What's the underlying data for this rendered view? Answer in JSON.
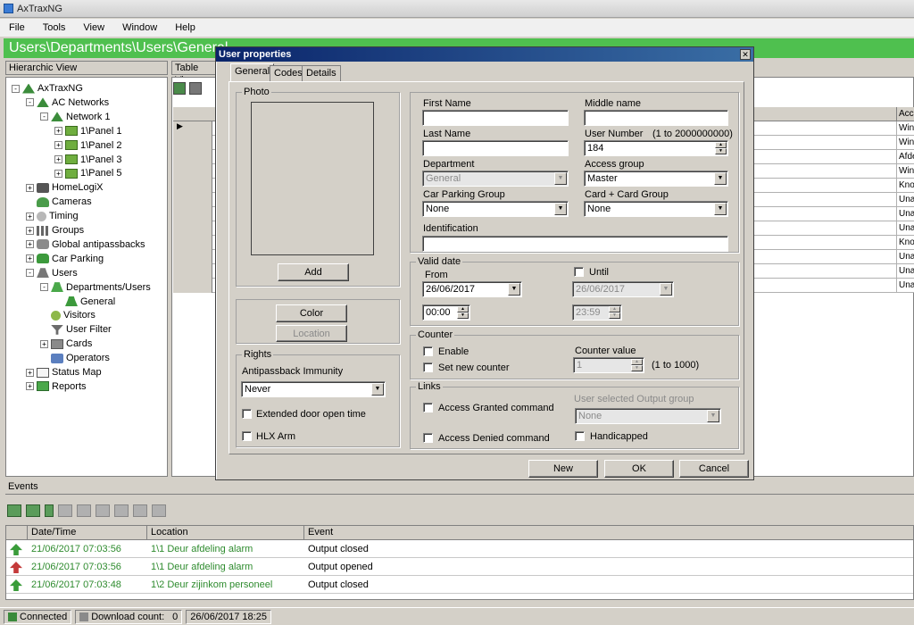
{
  "app": {
    "title": "AxTraxNG"
  },
  "menu": [
    "File",
    "Tools",
    "View",
    "Window",
    "Help"
  ],
  "path": "Users\\Departments\\Users\\General",
  "tree_header": "Hierarchic View",
  "table_header": "Table View",
  "tree": [
    {
      "label": "AxTraxNG",
      "level": 0,
      "exp": "-",
      "icon": "root-icon"
    },
    {
      "label": "AC Networks",
      "level": 1,
      "exp": "-",
      "icon": "network-icon"
    },
    {
      "label": "Network 1",
      "level": 2,
      "exp": "-",
      "icon": "network-icon"
    },
    {
      "label": "1\\Panel 1",
      "level": 3,
      "exp": "+",
      "icon": "panel-icon"
    },
    {
      "label": "1\\Panel 2",
      "level": 3,
      "exp": "+",
      "icon": "panel-icon"
    },
    {
      "label": "1\\Panel 3",
      "level": 3,
      "exp": "+",
      "icon": "panel-icon"
    },
    {
      "label": "1\\Panel 5",
      "level": 3,
      "exp": "+",
      "icon": "panel-icon"
    },
    {
      "label": "HomeLogiX",
      "level": 1,
      "exp": "+",
      "icon": "homelogix-icon"
    },
    {
      "label": "Cameras",
      "level": 1,
      "exp": "",
      "icon": "camera-icon"
    },
    {
      "label": "Timing",
      "level": 1,
      "exp": "+",
      "icon": "timing-icon"
    },
    {
      "label": "Groups",
      "level": 1,
      "exp": "+",
      "icon": "groups-icon"
    },
    {
      "label": "Global antipassbacks",
      "level": 1,
      "exp": "+",
      "icon": "antipassback-icon"
    },
    {
      "label": "Car Parking",
      "level": 1,
      "exp": "+",
      "icon": "car-icon"
    },
    {
      "label": "Users",
      "level": 1,
      "exp": "-",
      "icon": "users-icon"
    },
    {
      "label": "Departments/Users",
      "level": 2,
      "exp": "-",
      "icon": "departments-icon"
    },
    {
      "label": "General",
      "level": 3,
      "exp": "",
      "icon": "general-icon"
    },
    {
      "label": "Visitors",
      "level": 2,
      "exp": "",
      "icon": "visitors-icon"
    },
    {
      "label": "User Filter",
      "level": 2,
      "exp": "",
      "icon": "filter-icon"
    },
    {
      "label": "Cards",
      "level": 2,
      "exp": "+",
      "icon": "cards-icon"
    },
    {
      "label": "Operators",
      "level": 2,
      "exp": "",
      "icon": "operators-icon"
    },
    {
      "label": "Status Map",
      "level": 1,
      "exp": "+",
      "icon": "map-icon"
    },
    {
      "label": "Reports",
      "level": 1,
      "exp": "+",
      "icon": "reports-icon"
    }
  ],
  "grid": {
    "col_header": "Acce",
    "rows": [
      "Wink",
      "Wink",
      "Afde",
      "Wink",
      "Knop",
      "Unau",
      "Unau",
      "Unau",
      "Knop",
      "Unau",
      "Unau",
      "Unau"
    ]
  },
  "dialog": {
    "title": "User properties",
    "tabs": [
      "General",
      "Codes",
      "Details"
    ],
    "photo_group": "Photo",
    "add_button": "Add",
    "color_button": "Color",
    "location_button": "Location",
    "rights_group": "Rights",
    "antipassback_label": "Antipassback Immunity",
    "antipassback_value": "Never",
    "extended_door": "Extended door open time",
    "hlx_arm": "HLX Arm",
    "first_name_label": "First Name",
    "first_name_value": "",
    "middle_name_label": "Middle name",
    "middle_name_value": "",
    "last_name_label": "Last Name",
    "last_name_value": "",
    "user_number_label": "User Number",
    "user_number_range": "(1 to 2000000000)",
    "user_number_value": "184",
    "department_label": "Department",
    "department_value": "General",
    "access_group_label": "Access group",
    "access_group_value": "Master",
    "car_parking_label": "Car Parking Group",
    "car_parking_value": "None",
    "card_card_label": "Card + Card Group",
    "card_card_value": "None",
    "identification_label": "Identification",
    "identification_value": "",
    "valid_group": "Valid date",
    "from_label": "From",
    "from_date": "26/06/2017",
    "from_time": "00:00",
    "until_label": "Until",
    "until_date": "26/06/2017",
    "until_time": "23:59",
    "counter_group": "Counter",
    "enable_label": "Enable",
    "set_new_counter": "Set new counter",
    "counter_value_label": "Counter value",
    "counter_value": "1",
    "counter_range": "(1 to 1000)",
    "links_group": "Links",
    "access_granted": "Access Granted command",
    "access_denied": "Access Denied command",
    "user_output_label": "User selected Output group",
    "user_output_value": "None",
    "handicapped": "Handicapped",
    "new_button": "New",
    "ok_button": "OK",
    "cancel_button": "Cancel"
  },
  "events": {
    "header": "Events",
    "columns": [
      "Date/Time",
      "Location",
      "Event"
    ],
    "rows": [
      {
        "icon": "up",
        "time": "21/06/2017 07:03:56",
        "location": "1\\1 Deur afdeling alarm",
        "event": "Output closed"
      },
      {
        "icon": "dn",
        "time": "21/06/2017 07:03:56",
        "location": "1\\1 Deur afdeling alarm",
        "event": "Output opened"
      },
      {
        "icon": "up",
        "time": "21/06/2017 07:03:48",
        "location": "1\\2 Deur zijinkom personeel",
        "event": "Output closed"
      }
    ]
  },
  "status": {
    "connected": "Connected",
    "download_label": "Download count:",
    "download_value": "0",
    "datetime": "26/06/2017 18:25"
  }
}
